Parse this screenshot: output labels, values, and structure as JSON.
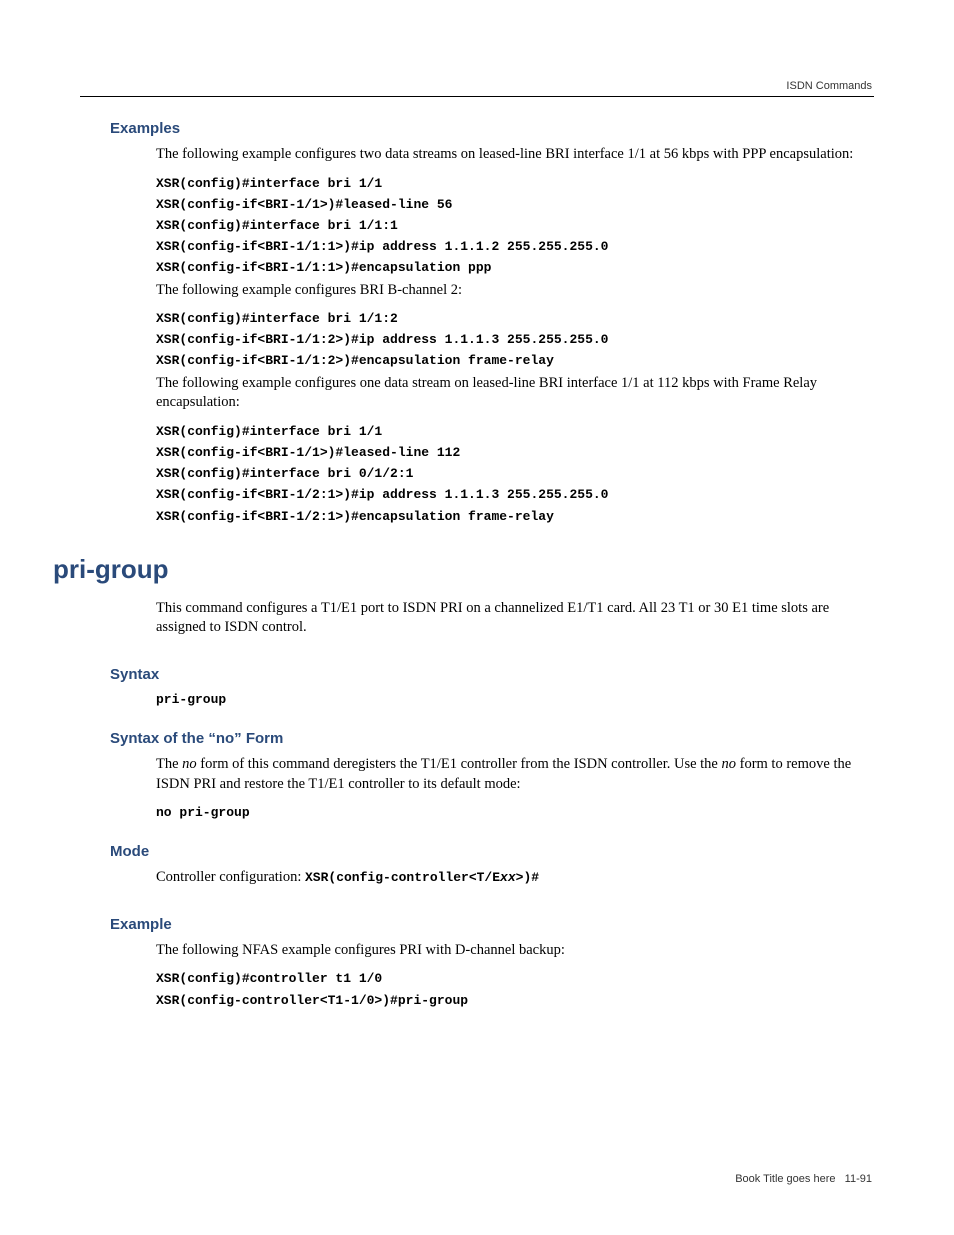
{
  "header": {
    "category": "ISDN Commands"
  },
  "sections": {
    "examples": {
      "heading": "Examples",
      "intro1": "The following example configures two data streams on leased-line BRI interface 1/1 at 56 kbps with PPP encapsulation:",
      "code1_l1": "XSR(config)#interface bri 1/1",
      "code1_l2": "XSR(config-if<BRI-1/1>)#leased-line 56",
      "code1_l3": "XSR(config)#interface bri 1/1:1",
      "code1_l4": "XSR(config-if<BRI-1/1:1>)#ip address 1.1.1.2 255.255.255.0",
      "code1_l5": "XSR(config-if<BRI-1/1:1>)#encapsulation ppp",
      "intro2": "The following example configures BRI B-channel 2:",
      "code2_l1": "XSR(config)#interface bri 1/1:2",
      "code2_l2": "XSR(config-if<BRI-1/1:2>)#ip address 1.1.1.3 255.255.255.0",
      "code2_l3": "XSR(config-if<BRI-1/1:2>)#encapsulation frame-relay",
      "intro3": "The following example configures one data stream on leased-line BRI interface 1/1 at 112 kbps with Frame Relay encapsulation:",
      "code3_l1": "XSR(config)#interface bri 1/1",
      "code3_l2": "XSR(config-if<BRI-1/1>)#leased-line 112",
      "code3_l3": "XSR(config)#interface bri 0/1/2:1",
      "code3_l4": "XSR(config-if<BRI-1/2:1>)#ip address 1.1.1.3 255.255.255.0",
      "code3_l5": "XSR(config-if<BRI-1/2:1>)#encapsulation frame-relay"
    },
    "prigroup": {
      "title": "pri-group",
      "desc": "This command configures a T1/E1 port to ISDN PRI on a channelized E1/T1 card. All 23 T1 or 30 E1 time slots are assigned to ISDN control.",
      "syntax_heading": "Syntax",
      "syntax_code": "pri-group",
      "syntaxno_heading": "Syntax of the “no” Form",
      "syntaxno_pre": "The ",
      "syntaxno_no1": "no",
      "syntaxno_mid": " form of this command deregisters the T1/E1 controller from the ISDN controller. Use the ",
      "syntaxno_no2": "no",
      "syntaxno_post": " form to remove the ISDN PRI and restore the T1/E1 controller to its default mode:",
      "syntaxno_code": "no pri-group",
      "mode_heading": "Mode",
      "mode_pre": "Controller configuration: ",
      "mode_code_pre": "XSR(config-controller<T/E",
      "mode_code_var": "xx",
      "mode_code_post": ">)#",
      "example_heading": "Example",
      "example_intro": "The following NFAS example configures PRI with D-channel backup:",
      "example_code_l1": "XSR(config)#controller t1 1/0",
      "example_code_l2": "XSR(config-controller<T1-1/0>)#pri-group"
    }
  },
  "footer": {
    "booktitle": "Book Title  goes here",
    "page": "11-91"
  }
}
